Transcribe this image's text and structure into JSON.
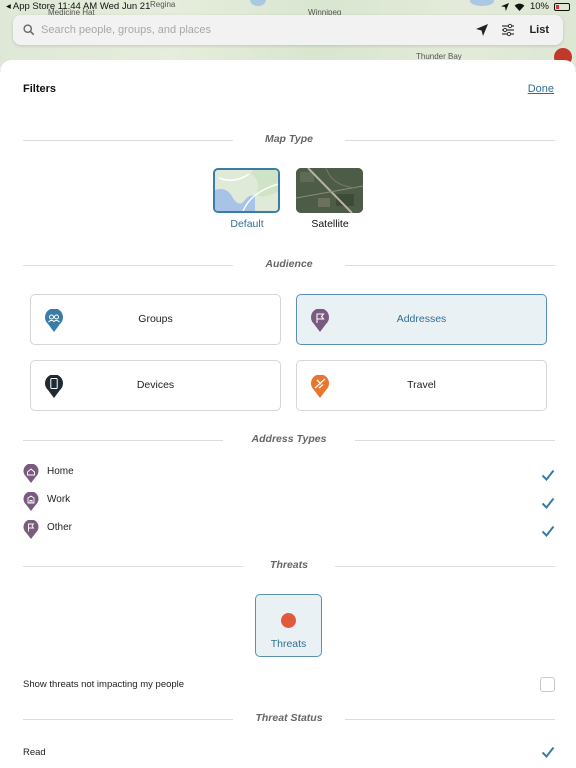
{
  "status_bar": {
    "left_text": "◂ App Store  11:44 AM  Wed Jun 21",
    "battery": "10%"
  },
  "map": {
    "labels": [
      "Medicine Hat",
      "Regina",
      "Winnipeg",
      "Thunder Bay"
    ]
  },
  "search": {
    "placeholder": "Search people, groups, and places",
    "list_label": "List"
  },
  "filters": {
    "title": "Filters",
    "done_label": "Done",
    "sections": {
      "map_type": "Map Type",
      "audience": "Audience",
      "address_types": "Address Types",
      "threats": "Threats",
      "threat_status": "Threat Status"
    },
    "map_types": [
      {
        "label": "Default",
        "selected": true
      },
      {
        "label": "Satellite",
        "selected": false
      }
    ],
    "audience": [
      {
        "label": "Groups",
        "icon": "groups-pin-icon",
        "color": "#3a7ca5",
        "selected": false
      },
      {
        "label": "Addresses",
        "icon": "flag-pin-icon",
        "color": "#7a5a7e",
        "selected": true
      },
      {
        "label": "Devices",
        "icon": "device-pin-icon",
        "color": "#1f2a33",
        "selected": false
      },
      {
        "label": "Travel",
        "icon": "plane-pin-icon",
        "color": "#e8762d",
        "selected": false
      }
    ],
    "address_types": [
      {
        "label": "Home",
        "icon": "home-pin-icon",
        "checked": true
      },
      {
        "label": "Work",
        "icon": "work-pin-icon",
        "checked": true
      },
      {
        "label": "Other",
        "icon": "flag-pin-icon",
        "checked": true
      }
    ],
    "threats_tile": {
      "label": "Threats",
      "selected": true
    },
    "show_not_impacting": {
      "label": "Show threats not impacting my people",
      "checked": false
    },
    "threat_status": [
      {
        "label": "Read",
        "checked": true
      }
    ]
  },
  "colors": {
    "accent": "#2f6f96",
    "address_pin": "#7a5a7e",
    "threat_dot": "#e05a3e",
    "selected_bg": "#eaf1f4"
  }
}
